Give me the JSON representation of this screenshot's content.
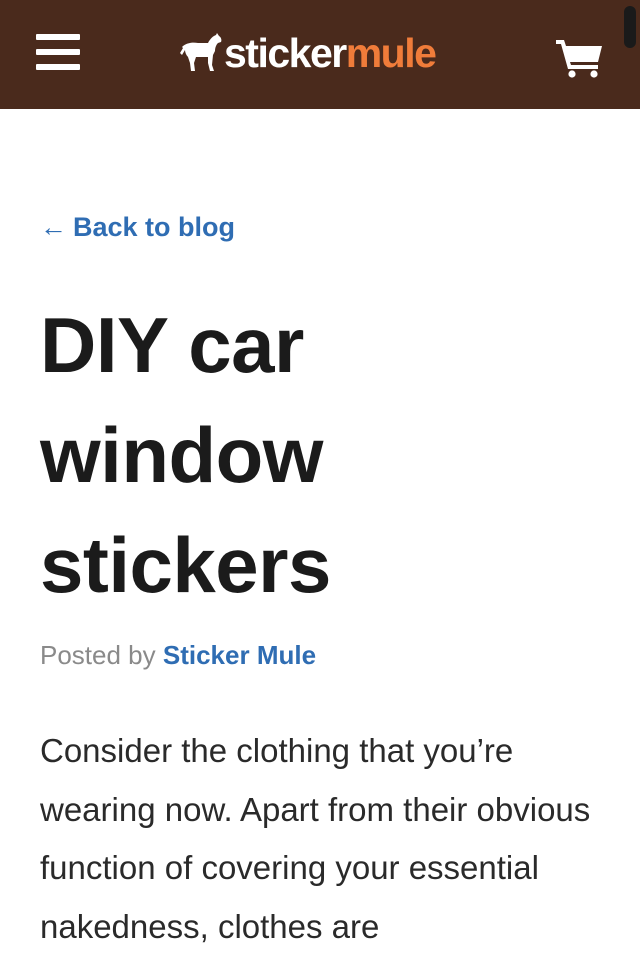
{
  "colors": {
    "header_bg": "#4a2a1c",
    "logo_accent": "#f07c3a",
    "link": "#2f6db3"
  },
  "header": {
    "menu_icon": "hamburger-menu-icon",
    "logo": {
      "icon": "mule-icon",
      "word1": "sticker",
      "word2": "mule"
    },
    "cart_icon": "shopping-cart-icon"
  },
  "article": {
    "back_arrow": "←",
    "back_label": "Back to blog",
    "title": "DIY car window stickers",
    "byline_prefix": "Posted by",
    "author": "Sticker Mule",
    "body": "Consider the clothing that you’re wearing now. Apart from their obvious function of covering your essential nakedness, clothes are"
  }
}
